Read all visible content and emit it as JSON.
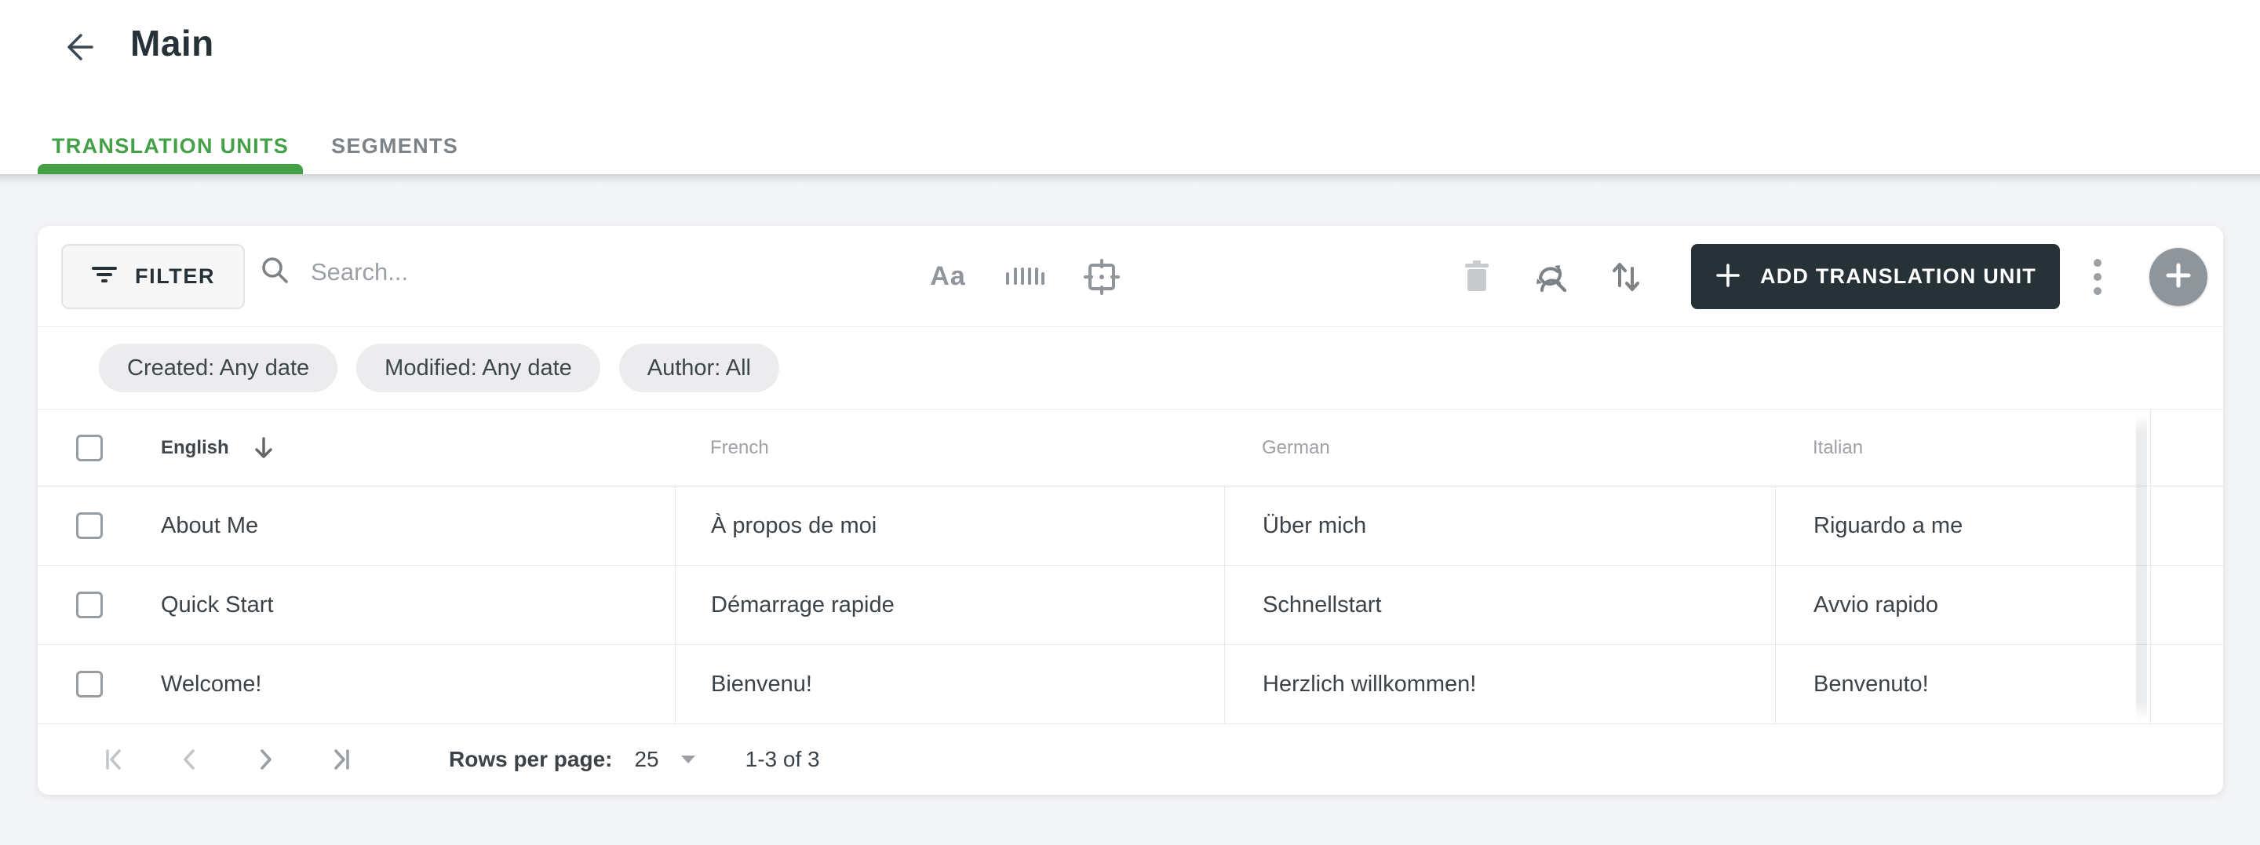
{
  "header": {
    "title": "Main"
  },
  "tabs": [
    {
      "label": "TRANSLATION UNITS",
      "active": true
    },
    {
      "label": "SEGMENTS",
      "active": false
    }
  ],
  "toolbar": {
    "filter_label": "FILTER",
    "search_placeholder": "Search...",
    "match_case_label": "Aa",
    "add_button_label": "ADD TRANSLATION UNIT"
  },
  "icons": {
    "back": "arrow-left",
    "filter": "filter-lines",
    "search": "magnifier",
    "match_case": "Aa-text",
    "whole_word": "barcode-bars",
    "exact_match": "target-frame",
    "delete": "trash",
    "find_replace": "circular-arrows-magnifier",
    "sort": "arrows-up-down",
    "add": "plus",
    "more": "kebab-vertical-dots",
    "quick_add": "plus-in-circle",
    "sort_column": "arrow-down",
    "rows_caret": "triangle-down",
    "pager": [
      "first-page",
      "previous-page",
      "next-page",
      "last-page"
    ]
  },
  "filter_chips": [
    {
      "label": "Created: Any date"
    },
    {
      "label": "Modified: Any date"
    },
    {
      "label": "Author: All"
    }
  ],
  "table": {
    "columns": [
      {
        "label": "English",
        "sorted": "desc"
      },
      {
        "label": "French"
      },
      {
        "label": "German"
      },
      {
        "label": "Italian"
      }
    ],
    "rows": [
      {
        "english": "About Me",
        "french": "À propos de moi",
        "german": "Über mich",
        "italian": "Riguardo a me"
      },
      {
        "english": "Quick Start",
        "french": "Démarrage rapide",
        "german": "Schnellstart",
        "italian": "Avvio rapido"
      },
      {
        "english": "Welcome!",
        "french": "Bienvenu!",
        "german": "Herzlich willkommen!",
        "italian": "Benvenuto!"
      }
    ]
  },
  "pagination": {
    "rows_per_page_label": "Rows per page:",
    "rows_per_page_value": "25",
    "range_label": "1-3 of 3"
  },
  "colors": {
    "accent_green": "#43A047",
    "dark_button": "#263238",
    "page_background": "#f3f4f6",
    "chip_background": "#ececee",
    "muted_text": "#9da1a5",
    "body_text": "#3c4348"
  }
}
